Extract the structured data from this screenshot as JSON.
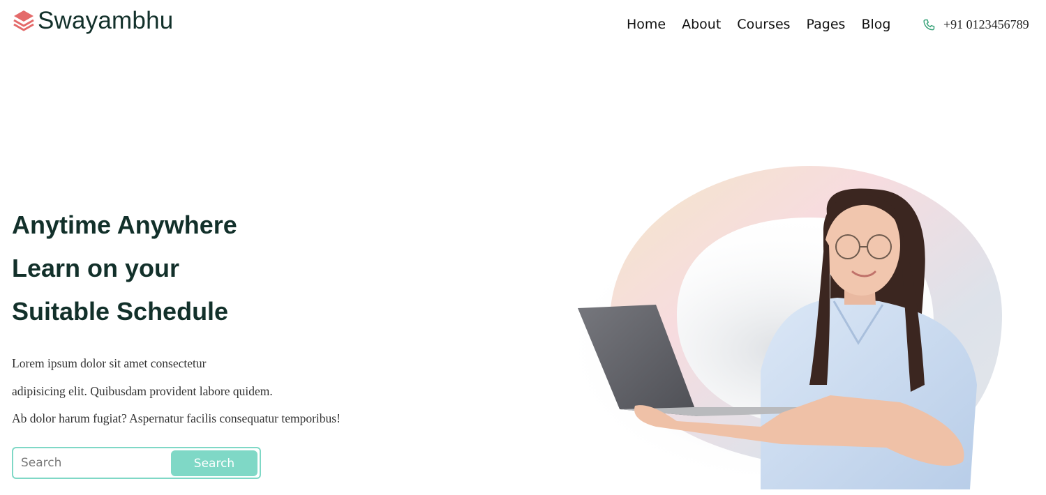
{
  "header": {
    "brand": "Swayambhu",
    "nav": [
      {
        "label": "Home"
      },
      {
        "label": "About"
      },
      {
        "label": "Courses"
      },
      {
        "label": "Pages"
      },
      {
        "label": "Blog"
      }
    ],
    "phone": "+91 0123456789"
  },
  "hero": {
    "title_lines": [
      "Anytime Anywhere",
      "Learn on your",
      "Suitable Schedule"
    ],
    "description_lines": [
      "Lorem ipsum dolor sit amet consectetur",
      "adipisicing elit. Quibusdam provident labore quidem.",
      "Ab dolor harum fugiat? Aspernatur facilis consequatur temporibus!"
    ],
    "search": {
      "placeholder": "Search",
      "value": "",
      "button_label": "Search"
    }
  },
  "colors": {
    "accent": "#7fd8c6",
    "brand_icon": "#e46a6a",
    "heading": "#12302a",
    "phone_icon": "#3aa37a"
  },
  "icons": {
    "logo": "layers-icon",
    "phone": "phone-icon"
  }
}
